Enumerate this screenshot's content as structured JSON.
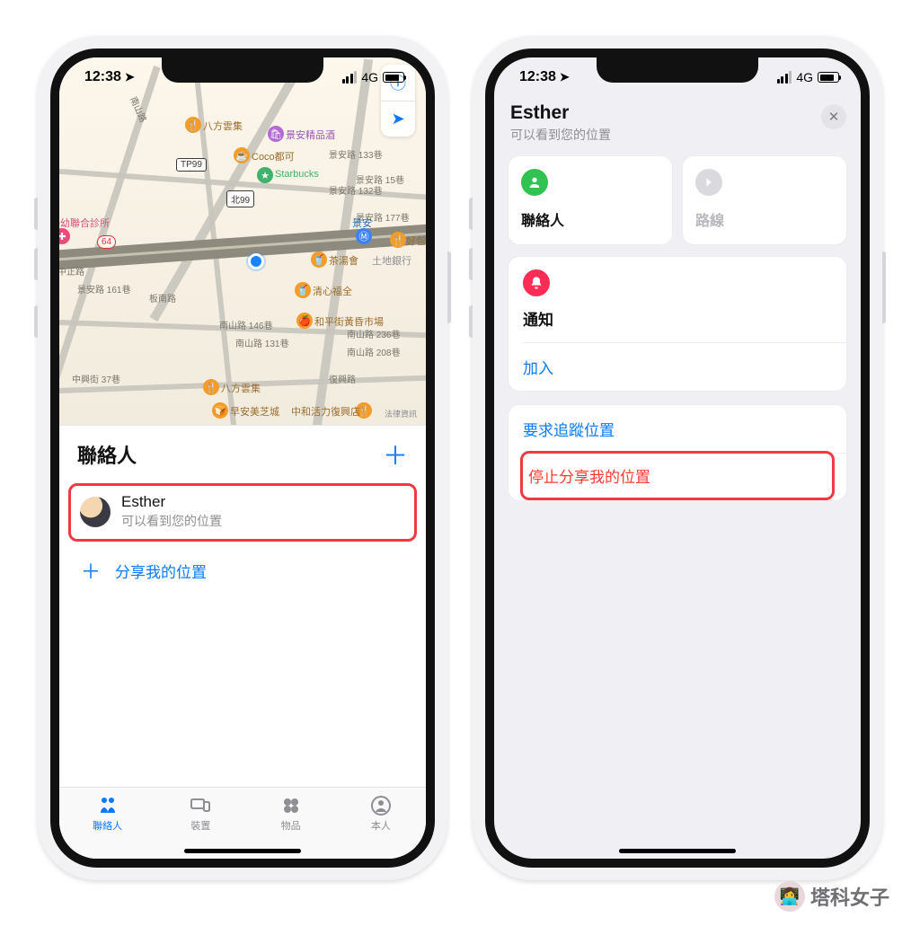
{
  "status": {
    "time": "12:38",
    "location_glyph": "➤",
    "network": "4G"
  },
  "left": {
    "map": {
      "controls": {
        "info_glyph": "ⓘ",
        "locate_glyph": "➤"
      },
      "shields": {
        "hw64": "64",
        "n99": "北99",
        "tp99": "TP99"
      },
      "poi": {
        "bafang1": "八方雲集",
        "bafang2": "八方雲集",
        "jingan_boutique": "景安精品酒",
        "coco": "Coco都可",
        "starbucks": "Starbucks",
        "jingan_station": "景安",
        "tea": "茶湯會",
        "bank": "土地銀行",
        "qingshuifu": "清心福全",
        "heping_market": "和平街黃昏市場",
        "breakfast": "早安美芝城",
        "zhonghe": "中和活力復興店",
        "clinic": "婦幼聯合診所",
        "baozi": "好包子"
      },
      "streets": {
        "zhongzheng": "中正路",
        "jingan133": "景安路 133巷",
        "jingan161": "景安路 161巷",
        "bannan": "板南路",
        "nanshan146": "南山路 146巷",
        "nanshan131": "南山路 131巷",
        "nanshan236": "南山路 236巷",
        "nanshan208": "南山路 208巷",
        "fuxing": "復興路",
        "zhongxing": "中興街 37巷",
        "jingan132": "景安路 132巷",
        "jingan15": "景安路 15巷",
        "jingan177": "景安路 177巷",
        "nanshan": "南山路"
      },
      "legal": "法律資訊"
    },
    "sheet": {
      "title": "聯絡人",
      "contact": {
        "name": "Esther",
        "sub": "可以看到您的位置"
      },
      "share_label": "分享我的位置"
    },
    "tabs": {
      "people": "聯絡人",
      "devices": "裝置",
      "items": "物品",
      "me": "本人"
    }
  },
  "right": {
    "header": {
      "name": "Esther",
      "sub": "可以看到您的位置"
    },
    "tiles": {
      "contact": "聯絡人",
      "route": "路線"
    },
    "notif": {
      "title": "通知",
      "add": "加入"
    },
    "actions": {
      "request": "要求追蹤位置",
      "stop": "停止分享我的位置"
    }
  },
  "watermark": "塔科女子"
}
